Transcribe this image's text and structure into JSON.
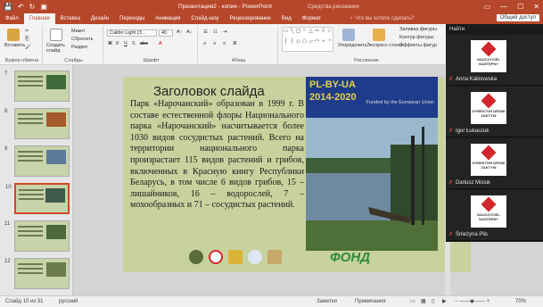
{
  "titlebar": {
    "file_title": "Презентация2 - копия - PowerPoint",
    "tools_label": "Средства рисования",
    "qat": [
      "💾",
      "↶",
      "↻",
      "▣"
    ],
    "win_controls": [
      "▭",
      "—",
      "☐",
      "✕"
    ]
  },
  "tabs": [
    "Файл",
    "Главная",
    "Вставка",
    "Дизайн",
    "Переходы",
    "Анимация",
    "Слайд-шоу",
    "Рецензирование",
    "Вид",
    "Формат"
  ],
  "tellme": "♀ Что вы хотите сделать?",
  "share": "Общий доступ",
  "ribbon": {
    "paste": "Вставить",
    "create": "Создать слайд",
    "layout": "Макет",
    "reset": "Сбросить",
    "section": "Раздел",
    "font_name": "Calibri Light (З...",
    "font_size": "40",
    "arrange": "Упорядочить",
    "quick_styles": "Экспресс-стили",
    "fill": "Заливка фигуры",
    "outline": "Контур фигуры",
    "effects": "Эффекты фигур",
    "find": "Найти",
    "groups": {
      "clipboard": "Буфер обмена",
      "slides": "Слайды",
      "font": "Шрифт",
      "paragraph": "Абзац",
      "drawing": "Рисование"
    },
    "shapes": [
      "▭",
      "╲",
      "▢",
      "○",
      "△",
      "⇨",
      "⇩",
      "☆",
      "{",
      "}",
      "◇",
      "⬠",
      "▱",
      "⌒",
      "⤷",
      "◔"
    ]
  },
  "thumbnails": [
    {
      "num": "7"
    },
    {
      "num": "8"
    },
    {
      "num": "9"
    },
    {
      "num": "10"
    },
    {
      "num": "11"
    },
    {
      "num": "12"
    }
  ],
  "slide": {
    "title": "Заголовок слайда",
    "body": "Парк «Нарочанский» образован в 1999 г. В составе естественной флоры Национального парка «Нарочанский» насчитывается более 1030 видов сосудистых растений. Всего на территории национального парка произрастает 115 видов растений и грибов, включенных в Красную книгу Республики Беларусь, в том числе 6 видов грибов, 15 – лишайников, 16 – водорослей, 7 – мохообразных и 71 – сосудистых растений.",
    "banner_line1": "PL-BY-UA",
    "banner_line2": "2014-2020",
    "banner_funded": "Funded by the European Union",
    "fund_logo": "ФОНД"
  },
  "participants_header": "Найти",
  "participants": [
    {
      "name": "Anna Kalinowska",
      "logo_text": "NAUCZYCIEL NASTĘPNY"
    },
    {
      "name": "Igor Łukaszuk",
      "logo_text": "DYREKTOR DRZWI ZAKTYW"
    },
    {
      "name": "Dariusz Misiuk",
      "logo_text": "DYREKTOR DRZWI ZAKTYW"
    },
    {
      "name": "Śnieżyna Plis",
      "logo_text": "NAUCZYCIEL NASTĘPNY"
    }
  ],
  "status": {
    "slide_info": "Слайд 10 из 31",
    "language": "русский",
    "notes": "Заметки",
    "comments": "Примечания",
    "zoom": "70%"
  },
  "colors": {
    "accent": "#b7472a",
    "slide_bg": "#c8d29e",
    "banner": "#1f3c8a",
    "logo_red": "#d2262d"
  }
}
